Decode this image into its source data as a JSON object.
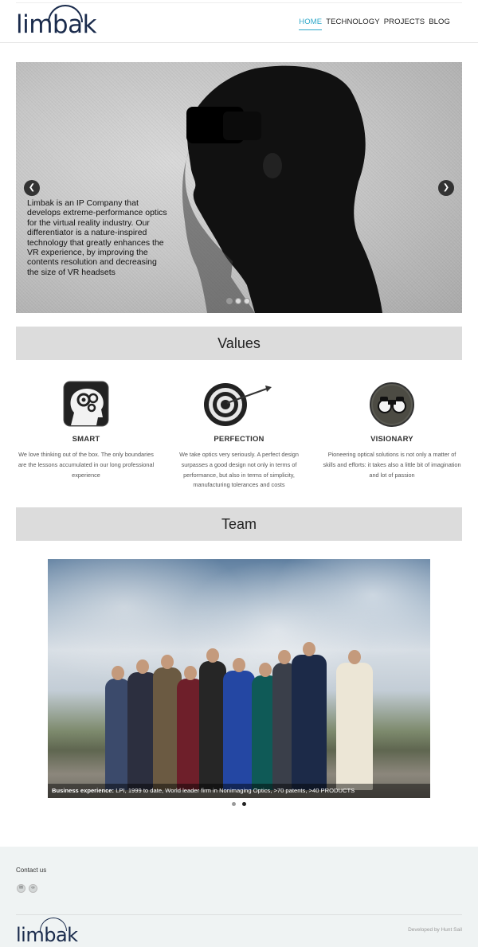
{
  "header": {
    "logo": "limbak",
    "nav": [
      "HOME",
      "TECHNOLOGY",
      "PROJECTS",
      "BLOG"
    ],
    "active": "HOME"
  },
  "hero": {
    "text": "Limbak is an IP Company that develops extreme-performance optics for the virtual reality industry. Our differentiator is a nature-inspired technology that greatly enhances the VR experience, by improving the contents resolution and decreasing the size of VR headsets",
    "prev_icon": "chevron-left-icon",
    "next_icon": "chevron-right-icon",
    "slide_count": 3,
    "active_slide": 1
  },
  "values": {
    "heading": "Values",
    "items": [
      {
        "title": "SMART",
        "icon": "head-gears-icon",
        "desc": "We love thinking out of the box. The only boundaries are the lessons accumulated in our long professional experience"
      },
      {
        "title": "PERFECTION",
        "icon": "target-arrow-icon",
        "desc": "We take optics very seriously. A perfect design surpasses a good design not only in terms of performance, but also in terms of simplicity, manufacturing tolerances and costs"
      },
      {
        "title": "VISIONARY",
        "icon": "binoculars-icon",
        "desc": "Pioneering optical solutions is not only a matter of skills and efforts: it takes also a little bit of imagination and lot of passion"
      }
    ]
  },
  "team": {
    "heading": "Team",
    "caption_bold": "Business experience:",
    "caption_rest": " LPI, 1999 to date, World leader firm in Nonimaging Optics, >70 patents, >40 PRODUCTS",
    "slide_count": 2,
    "active_slide": 2
  },
  "footer": {
    "contact": "Contact us",
    "socials": [
      "mail-icon",
      "link-icon"
    ],
    "logo": "limbak",
    "credit": "Developed by Hunt Sail"
  }
}
